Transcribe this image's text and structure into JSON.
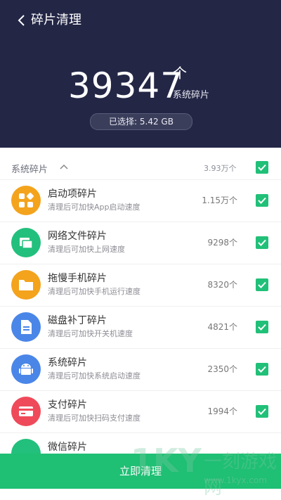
{
  "header": {
    "title": "碎片清理",
    "total_count": "39347",
    "unit": "个",
    "unit_sub": "系统碎片",
    "selected_text": "已选择: 5.42 GB"
  },
  "group": {
    "label": "系统碎片",
    "count": "3.93万个"
  },
  "items": [
    {
      "title": "启动项碎片",
      "desc": "清理后可加快App启动速度",
      "count": "1.15万个",
      "icon": "apps-grid-icon",
      "color": "#f4a31c"
    },
    {
      "title": "网络文件碎片",
      "desc": "清理后可加快上网速度",
      "count": "9298个",
      "icon": "network-folder-icon",
      "color": "#22c07c"
    },
    {
      "title": "拖慢手机碎片",
      "desc": "清理后可加快手机运行速度",
      "count": "8320个",
      "icon": "folder-icon",
      "color": "#f4a31c"
    },
    {
      "title": "磁盘补丁碎片",
      "desc": "清理后可加快开关机速度",
      "count": "4821个",
      "icon": "document-icon",
      "color": "#4a86e8"
    },
    {
      "title": "系统碎片",
      "desc": "清理后可加快系统启动速度",
      "count": "2350个",
      "icon": "android-icon",
      "color": "#4a86e8"
    },
    {
      "title": "支付碎片",
      "desc": "清理后可加快扫码支付速度",
      "count": "1994个",
      "icon": "card-icon",
      "color": "#ef4a5a"
    },
    {
      "title": "微信碎片",
      "desc": "",
      "count": "",
      "icon": "chat-icon",
      "color": "#22c07c"
    }
  ],
  "clean_button": "立即清理",
  "watermark": {
    "big": "1KY",
    "cn": "一刻游戏网",
    "url": "www.1kyx.com"
  }
}
